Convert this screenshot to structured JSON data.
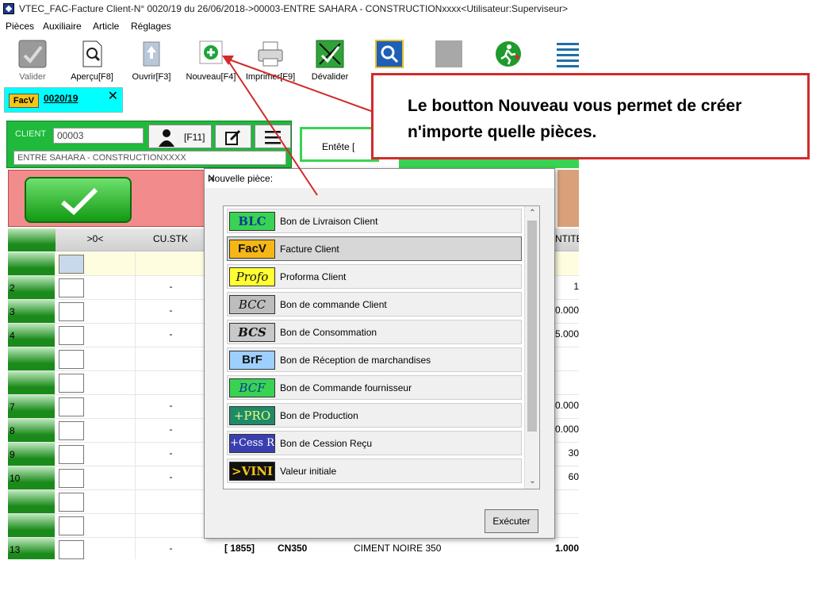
{
  "window": {
    "title": "VTEC_FAC-Facture Client-N° 0020/19 du 26/06/2018->00003-ENTRE SAHARA - CONSTRUCTIONxxxx<Utilisateur:Superviseur>"
  },
  "menu": [
    "Pièces",
    "Auxiliaire",
    "Article",
    "Réglages"
  ],
  "toolbar": {
    "valider": "Valider",
    "apercu": "Aperçu[F8]",
    "ouvrir": "Ouvrir[F3]",
    "nouveau": "Nouveau[F4]",
    "imprimer": "Imprimer[F9]",
    "devalider": "Dévalider"
  },
  "doc_tab": {
    "badge": "FacV",
    "number": "0020/19",
    "close": "✕"
  },
  "client": {
    "label": "CLIENT",
    "code": "00003",
    "f11": "[F11]",
    "name": "ENTRE SAHARA - CONSTRUCTIONXXXX"
  },
  "entete": "Entête [",
  "grid": {
    "headers": {
      "col1": ">0<",
      "col2": "CU.STK",
      "col5": "NTITE"
    },
    "rows": [
      {
        "num": "",
        "cu": "",
        "qty": ""
      },
      {
        "num": "2",
        "cu": "-",
        "qty": "1"
      },
      {
        "num": "3",
        "cu": "-",
        "qty": "0.000"
      },
      {
        "num": "4",
        "cu": "-",
        "qty": "5.000"
      },
      {
        "num": "",
        "cu": "",
        "qty": ""
      },
      {
        "num": "",
        "cu": "",
        "qty": ""
      },
      {
        "num": "7",
        "cu": "-",
        "qty": "0.000"
      },
      {
        "num": "8",
        "cu": "-",
        "qty": "0.000"
      },
      {
        "num": "9",
        "cu": "-",
        "qty": "30"
      },
      {
        "num": "10",
        "cu": "-",
        "qty": "60"
      },
      {
        "num": "",
        "cu": "",
        "qty": ""
      },
      {
        "num": "",
        "cu": "",
        "qty": ""
      }
    ],
    "last": {
      "num": "13",
      "cu": "-",
      "ref": "[ 1855]",
      "code": "CN350",
      "designation": "CIMENT NOIRE 350",
      "qty": "1.000"
    }
  },
  "dialog": {
    "title": "Nouvelle pièce:",
    "close": "✕",
    "items": [
      {
        "badge": "BLC",
        "label": "Bon de Livraison Client"
      },
      {
        "badge": "FacV",
        "label": "Facture Client"
      },
      {
        "badge": "Profo",
        "label": "Proforma Client"
      },
      {
        "badge": "BCC",
        "label": "Bon de commande Client"
      },
      {
        "badge": "BCS",
        "label": "Bon de Consommation"
      },
      {
        "badge": "BrF",
        "label": "Bon de Réception de marchandises"
      },
      {
        "badge": "BCF",
        "label": "Bon de Commande fournisseur"
      },
      {
        "badge": "+PRO",
        "label": "Bon de Production"
      },
      {
        "badge": "+Cess R",
        "label": "Bon de Cession Reçu"
      },
      {
        "badge": ">VINI",
        "label": "Valeur initiale"
      }
    ],
    "execute": "Exécuter"
  },
  "callout": {
    "text": "Le boutton Nouveau vous permet de créer n'importe quelle pièces."
  },
  "colors": {
    "accent_green": "#1fb93b",
    "callout_red": "#d12b2b",
    "tab_cyan": "#00ffff"
  }
}
